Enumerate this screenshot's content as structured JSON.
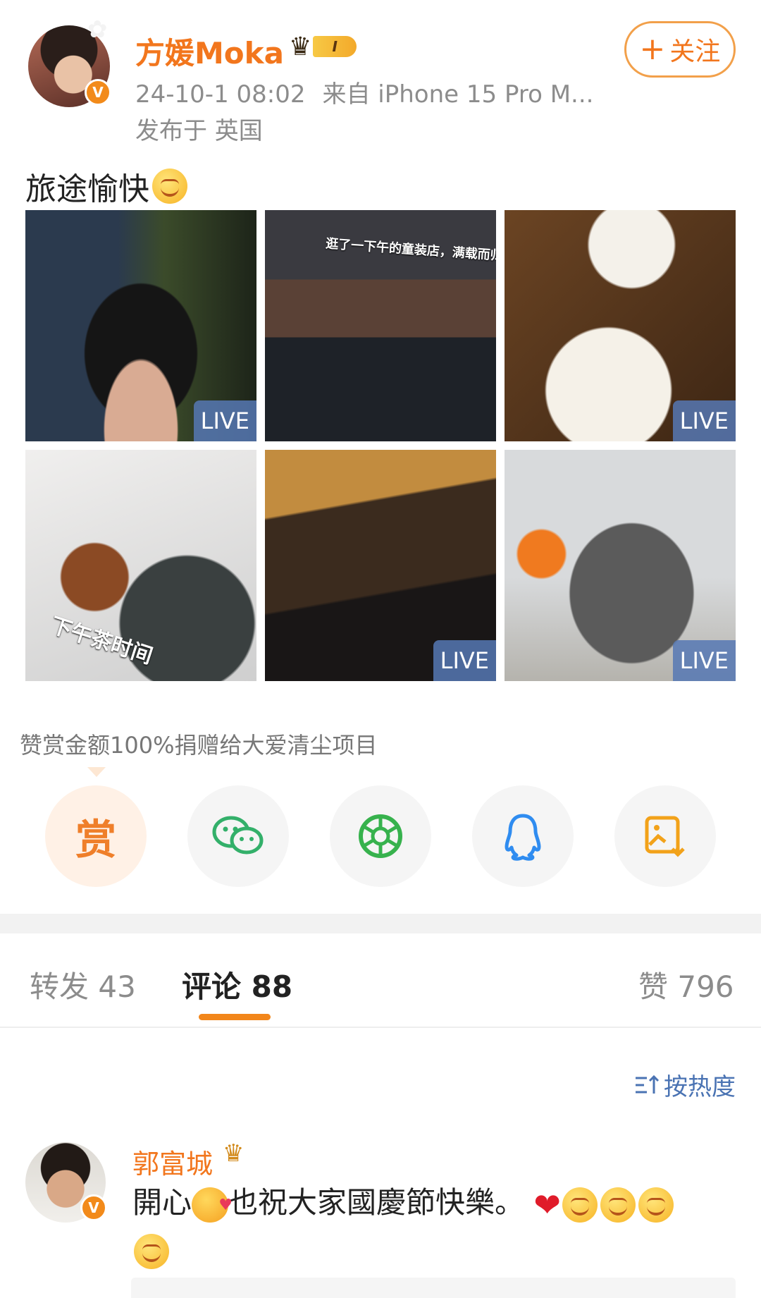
{
  "post": {
    "author": {
      "name": "方媛Moka",
      "vip_level": "I",
      "verified": true
    },
    "meta": {
      "time": "24-10-1 08:02",
      "source": "来自 iPhone 15 Pro M...",
      "location": "发布于 英国"
    },
    "follow_label": "关注",
    "text": "旅途愉快",
    "photos": [
      {
        "caption": "",
        "live": "LIVE"
      },
      {
        "caption": "逛了一下午的童装店，满载而归",
        "live": ""
      },
      {
        "caption": "",
        "live": "LIVE"
      },
      {
        "caption": "下午茶时间",
        "live": ""
      },
      {
        "caption": "",
        "live": "LIVE"
      },
      {
        "caption": "",
        "live": "LIVE"
      }
    ]
  },
  "reward": {
    "note": "赞赏金额100%捐赠给大爱清尘项目",
    "reward_char": "赏"
  },
  "share": {
    "items": [
      "reward-icon",
      "wechat-icon",
      "moments-icon",
      "qq-icon",
      "save-image-icon"
    ]
  },
  "tabs": {
    "repost": "转发 43",
    "comments": "评论 88",
    "likes": "赞 796"
  },
  "sort": {
    "label": "按热度"
  },
  "comment": {
    "author": "郭富城",
    "text_part1": "開心",
    "text_part2": "也祝大家國慶節快樂。"
  },
  "colors": {
    "accent": "#f2761d",
    "link": "#4a73b3",
    "live_tag": "#5678b4"
  }
}
